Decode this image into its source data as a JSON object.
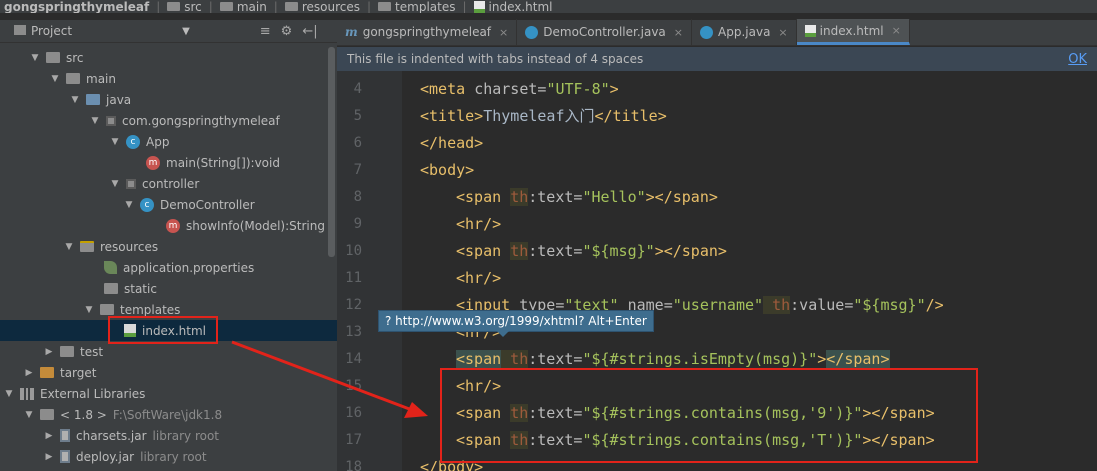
{
  "breadcrumb": [
    {
      "label": "gongspringthymeleaf",
      "icon": "folder-icon"
    },
    {
      "label": "src",
      "icon": "folder-icon"
    },
    {
      "label": "main",
      "icon": "folder-icon"
    },
    {
      "label": "resources",
      "icon": "folder-icon"
    },
    {
      "label": "templates",
      "icon": "folder-icon"
    },
    {
      "label": "index.html",
      "icon": "html-file-icon"
    }
  ],
  "project_panel": {
    "title": "Project",
    "tools": [
      "≡",
      "⚙",
      "←|"
    ]
  },
  "tree": [
    {
      "label": "src",
      "extra": ""
    },
    {
      "label": "main",
      "extra": ""
    },
    {
      "label": "java",
      "extra": ""
    },
    {
      "label": "com.gongspringthymeleaf",
      "extra": ""
    },
    {
      "label": "App",
      "extra": ""
    },
    {
      "label": "main(String[]):void",
      "extra": ""
    },
    {
      "label": "controller",
      "extra": ""
    },
    {
      "label": "DemoController",
      "extra": ""
    },
    {
      "label": "showInfo(Model):String",
      "extra": ""
    },
    {
      "label": "resources",
      "extra": ""
    },
    {
      "label": "application.properties",
      "extra": ""
    },
    {
      "label": "static",
      "extra": ""
    },
    {
      "label": "templates",
      "extra": ""
    },
    {
      "label": "index.html",
      "extra": ""
    },
    {
      "label": "test",
      "extra": ""
    },
    {
      "label": "target",
      "extra": ""
    },
    {
      "label": "External Libraries",
      "extra": ""
    },
    {
      "label": "< 1.8 >",
      "extra": "F:\\SoftWare\\jdk1.8"
    },
    {
      "label": "charsets.jar",
      "extra": "library root"
    },
    {
      "label": "deploy.jar",
      "extra": "library root"
    }
  ],
  "tabs": [
    {
      "label": "gongspringthymeleaf",
      "prefix": "m"
    },
    {
      "label": "DemoController.java",
      "prefix": ""
    },
    {
      "label": "App.java",
      "prefix": ""
    },
    {
      "label": "index.html",
      "prefix": ""
    }
  ],
  "notice": {
    "message": "This file is indented with tabs instead of 4 spaces",
    "action": "OK"
  },
  "line_numbers": [
    "4",
    "5",
    "6",
    "7",
    "8",
    "9",
    "10",
    "11",
    "12",
    "13",
    "14",
    "15",
    "16",
    "17",
    "18"
  ],
  "code": {
    "l4": {
      "open": "<meta ",
      "attr": "charset=",
      "val": "\"UTF-8\"",
      "close": ">"
    },
    "l5": {
      "open": "<title>",
      "text": "Thymeleaf入门",
      "close": "</title>"
    },
    "l6": "</head>",
    "l7": "<body>",
    "l8": {
      "open": "<span ",
      "th": "th",
      "attr": ":text=",
      "val": "\"Hello\"",
      "close": "></span>"
    },
    "l9": "<hr/>",
    "l10": {
      "open": "<span ",
      "th": "th",
      "attr": ":text=",
      "val": "\"${msg}\"",
      "close": "></span>"
    },
    "l11": "<hr/>",
    "l12": {
      "open": "<input ",
      "attr1": "type=",
      "val1": "\"text\"",
      "attr2": " name=",
      "val2": "\"username\"",
      "th": " th",
      "attr3": ":value=",
      "val3": "\"${msg}\"",
      "close": "/>"
    },
    "l13": "<hr/>",
    "l14": {
      "open": "<span",
      "th": " th",
      "attr": ":text=",
      "val": "\"${#strings.isEmpty(msg)}\"",
      "mid": ">",
      "close": "</span>"
    },
    "l15": "<hr/>",
    "l16": {
      "open": "<span ",
      "th": "th",
      "attr": ":text=",
      "val": "\"${#strings.contains(msg,'9')}\"",
      "close": "></span>"
    },
    "l17": {
      "open": "<span ",
      "th": "th",
      "attr": ":text=",
      "val": "\"${#strings.contains(msg,'T')}\"",
      "close": "></span>"
    },
    "l18": "</body>"
  },
  "tooltip": "? http://www.w3.org/1999/xhtml? Alt+Enter",
  "colors": {
    "accent": "#4a88c7",
    "annotation": "#e2231a",
    "tooltip_bg": "#3e6d8e"
  }
}
